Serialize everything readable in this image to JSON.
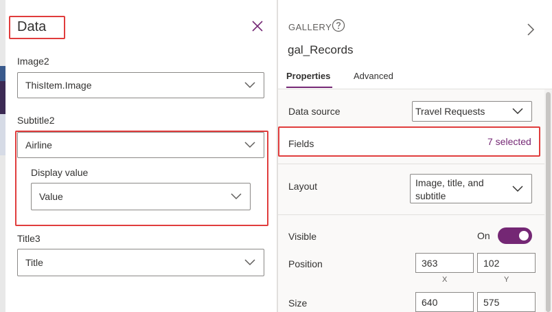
{
  "data_pane": {
    "title": "Data",
    "fields": [
      {
        "label": "Image2",
        "value": "ThisItem.Image"
      },
      {
        "label": "Subtitle2",
        "value": "Airline",
        "sub_label": "Display value",
        "sub_value": "Value"
      },
      {
        "label": "Title3",
        "value": "Title"
      }
    ]
  },
  "properties_pane": {
    "control_type": "GALLERY",
    "control_name": "gal_Records",
    "tabs": [
      "Properties",
      "Advanced"
    ],
    "data_source_label": "Data source",
    "data_source_value": "Travel Requests",
    "fields_label": "Fields",
    "fields_value": "7 selected",
    "layout_label": "Layout",
    "layout_value_line1": "Image, title, and",
    "layout_value_line2": "subtitle",
    "visible_label": "Visible",
    "visible_value": "On",
    "position_label": "Position",
    "position_x": "363",
    "position_y": "102",
    "axis_x": "X",
    "axis_y": "Y",
    "size_label": "Size",
    "size_w": "640",
    "size_h": "575"
  },
  "colors": {
    "accent": "#742774",
    "highlight_border": "#e03c3c"
  }
}
